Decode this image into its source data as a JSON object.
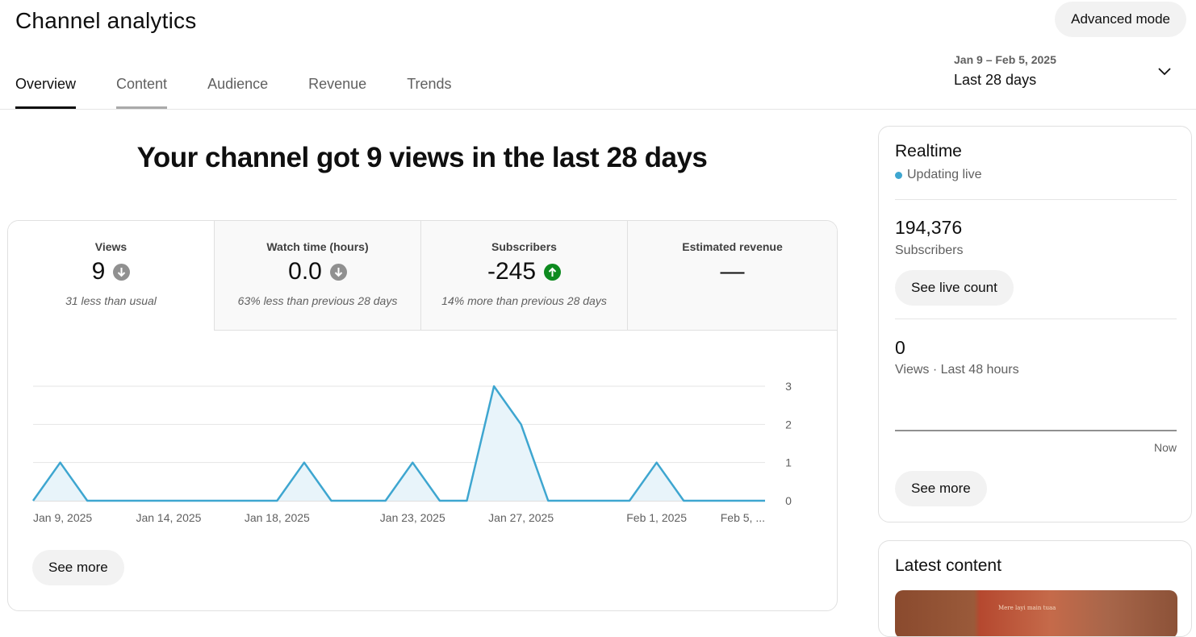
{
  "header": {
    "title": "Channel analytics",
    "advanced_mode_label": "Advanced mode"
  },
  "tabs": [
    {
      "label": "Overview",
      "state": "active"
    },
    {
      "label": "Content",
      "state": "hover"
    },
    {
      "label": "Audience",
      "state": "default"
    },
    {
      "label": "Revenue",
      "state": "default"
    },
    {
      "label": "Trends",
      "state": "default"
    }
  ],
  "date_picker": {
    "range": "Jan 9 – Feb 5, 2025",
    "label": "Last 28 days",
    "icon": "chevron-down-icon"
  },
  "headline": "Your channel got 9 views in the last 28 days",
  "metrics": [
    {
      "label": "Views",
      "value": "9",
      "trend": "down",
      "note": "31 less than usual",
      "selected": true
    },
    {
      "label": "Watch time (hours)",
      "value": "0.0",
      "trend": "down",
      "note": "63% less than previous 28 days",
      "selected": false
    },
    {
      "label": "Subscribers",
      "value": "-245",
      "trend": "up",
      "note": "14% more than previous 28 days",
      "selected": false
    },
    {
      "label": "Estimated revenue",
      "value": "—",
      "trend": "none",
      "note": "",
      "selected": false
    }
  ],
  "chart_data": {
    "type": "area",
    "x": [
      "Jan 9",
      "Jan 10",
      "Jan 11",
      "Jan 12",
      "Jan 13",
      "Jan 14",
      "Jan 15",
      "Jan 16",
      "Jan 17",
      "Jan 18",
      "Jan 19",
      "Jan 20",
      "Jan 21",
      "Jan 22",
      "Jan 23",
      "Jan 24",
      "Jan 25",
      "Jan 26",
      "Jan 27",
      "Jan 28",
      "Jan 29",
      "Jan 30",
      "Jan 31",
      "Feb 1",
      "Feb 2",
      "Feb 3",
      "Feb 4",
      "Feb 5"
    ],
    "values": [
      0,
      1,
      0,
      0,
      0,
      0,
      0,
      0,
      0,
      0,
      1,
      0,
      0,
      0,
      1,
      0,
      0,
      3,
      2,
      0,
      0,
      0,
      0,
      1,
      0,
      0,
      0,
      0
    ],
    "x_tick_labels": [
      {
        "index": 0,
        "label": "Jan 9, 2025"
      },
      {
        "index": 5,
        "label": "Jan 14, 2025"
      },
      {
        "index": 9,
        "label": "Jan 18, 2025"
      },
      {
        "index": 14,
        "label": "Jan 23, 2025"
      },
      {
        "index": 18,
        "label": "Jan 27, 2025"
      },
      {
        "index": 23,
        "label": "Feb 1, 2025"
      },
      {
        "index": 27,
        "label": "Feb 5, ..."
      }
    ],
    "y_ticks": [
      0,
      1,
      2,
      3
    ],
    "ylim": [
      0,
      3
    ],
    "line_color": "#3ea6d0",
    "fill_color": "#e8f4fa",
    "grid": true
  },
  "main_see_more_label": "See more",
  "realtime": {
    "title": "Realtime",
    "status": "Updating live",
    "subscribers_value": "194,376",
    "subscribers_label": "Subscribers",
    "live_count_label": "See live count",
    "views_value": "0",
    "views_label": "Views · Last 48 hours",
    "axis_end_label": "Now",
    "see_more_label": "See more",
    "live_color": "#3ea6d0"
  },
  "latest": {
    "title": "Latest content",
    "thumbnail_text": "Mere layi main tuaa"
  },
  "colors": {
    "accent": "#3ea6d0",
    "trend_up": "#0d8a1f",
    "trend_down": "#909090"
  }
}
